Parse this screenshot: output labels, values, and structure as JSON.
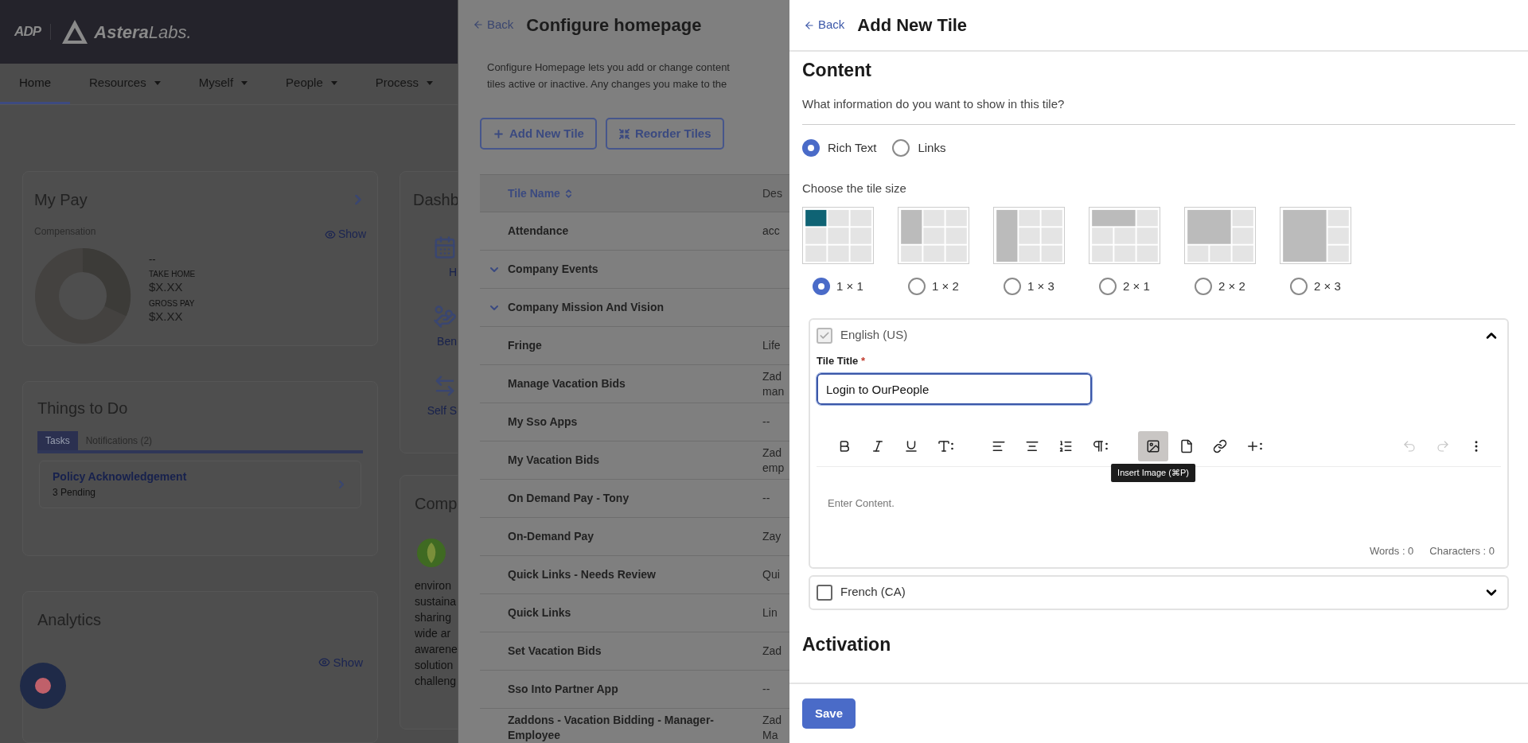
{
  "app_header": {
    "logo_mark": "ADP",
    "brand_name": "Astera",
    "brand_suffix": "Labs."
  },
  "nav": [
    {
      "label": "Home",
      "selected": true,
      "dropdown": false
    },
    {
      "label": "Resources",
      "selected": false,
      "dropdown": true
    },
    {
      "label": "Myself",
      "selected": false,
      "dropdown": true
    },
    {
      "label": "People",
      "selected": false,
      "dropdown": true
    },
    {
      "label": "Process",
      "selected": false,
      "dropdown": true
    }
  ],
  "my_pay": {
    "title": "My Pay",
    "subtitle": "Compensation",
    "show": "Show",
    "summary": "--",
    "items": [
      {
        "label": "TAKE HOME",
        "value": "$X.XX"
      },
      {
        "label": "GROSS PAY",
        "value": "$X.XX"
      }
    ]
  },
  "dashboard": {
    "title": "Dashb",
    "items": [
      {
        "kind": "calendar",
        "label": "H"
      },
      {
        "kind": "benefits",
        "label": "Ben"
      },
      {
        "kind": "swap",
        "label": "Self S"
      }
    ]
  },
  "things_to_do": {
    "title": "Things to Do",
    "tabs": [
      {
        "label": "Tasks",
        "selected": true
      },
      {
        "label": "Notifications (2)",
        "selected": false
      }
    ],
    "tasks": [
      {
        "title": "Policy Acknowledgement",
        "status": "3 Pending"
      }
    ]
  },
  "company": {
    "title": "Comp",
    "lines": [
      "environ",
      "sustaina",
      "sharing",
      "wide ar",
      "awarene",
      "solution",
      "challeng"
    ]
  },
  "analytics": {
    "title": "Analytics",
    "show": "Show"
  },
  "configure": {
    "back": "Back",
    "title": "Configure homepage",
    "description": [
      "Configure Homepage lets you add or change content",
      "tiles active or inactive. Any changes you make to the"
    ],
    "buttons": [
      {
        "kind": "add",
        "label": "Add New Tile"
      },
      {
        "kind": "reorder",
        "label": "Reorder Tiles"
      }
    ],
    "table": {
      "columns": [
        "Tile Name",
        "Des"
      ],
      "rows": [
        {
          "name": "Attendance",
          "expandable": false,
          "description": [
            "acc"
          ]
        },
        {
          "name": "Company Events",
          "expandable": true,
          "description": []
        },
        {
          "name": "Company Mission And Vision",
          "expandable": true,
          "description": []
        },
        {
          "name": "Fringe",
          "expandable": false,
          "description": [
            "Life"
          ]
        },
        {
          "name": "Manage Vacation Bids",
          "expandable": false,
          "description": [
            "Zad",
            "man"
          ]
        },
        {
          "name": "My Sso Apps",
          "expandable": false,
          "description": [
            "--"
          ]
        },
        {
          "name": "My Vacation Bids",
          "expandable": false,
          "description": [
            "Zad",
            "emp"
          ]
        },
        {
          "name": "On Demand Pay - Tony",
          "expandable": false,
          "description": [
            "--"
          ]
        },
        {
          "name": "On-Demand Pay",
          "expandable": false,
          "description": [
            "Zay"
          ]
        },
        {
          "name": "Quick Links - Needs Review",
          "expandable": false,
          "description": [
            "Qui"
          ]
        },
        {
          "name": "Quick Links",
          "expandable": false,
          "description": [
            "Lin"
          ]
        },
        {
          "name": "Set Vacation Bids",
          "expandable": false,
          "description": [
            "Zad"
          ]
        },
        {
          "name": "Sso Into Partner App",
          "expandable": false,
          "description": [
            "--"
          ]
        },
        {
          "name": "Zaddons - Vacation Bidding - Manager-Employee",
          "expandable": false,
          "description": [
            "Zad",
            "Ma"
          ]
        }
      ]
    }
  },
  "add_tile": {
    "back": "Back",
    "title": "Add New Tile",
    "content_heading": "Content",
    "question": "What information do you want to show in this tile?",
    "content_types": [
      {
        "label": "Rich Text",
        "selected": true
      },
      {
        "label": "Links",
        "selected": false
      }
    ],
    "size_prompt": "Choose the tile size",
    "sizes": [
      {
        "kind": "single",
        "label": "1 × 1",
        "selected": true
      },
      {
        "kind": "tall",
        "label": "1 × 2",
        "selected": false
      },
      {
        "kind": "column",
        "label": "1 × 3",
        "selected": false
      },
      {
        "kind": "wide",
        "label": "2 × 1",
        "selected": false
      },
      {
        "kind": "square",
        "label": "2 × 2",
        "selected": false
      },
      {
        "kind": "large",
        "label": "2 × 3",
        "selected": false
      }
    ],
    "languages": [
      {
        "label": "English (US)",
        "checked": true,
        "disabled": true,
        "expanded": true,
        "field_label": "Tile Title",
        "required_mark": "*",
        "value": "Login to OurPeople",
        "toolbar": [
          [
            {
              "kind": "bold",
              "active": false,
              "disabled": false
            },
            {
              "kind": "italic",
              "active": false,
              "disabled": false
            },
            {
              "kind": "underline",
              "active": false,
              "disabled": false
            },
            {
              "kind": "font_size",
              "active": false,
              "disabled": false
            }
          ],
          [
            {
              "kind": "align_left",
              "active": false,
              "disabled": false
            },
            {
              "kind": "align_center",
              "active": false,
              "disabled": false
            },
            {
              "kind": "ordered_list",
              "active": false,
              "disabled": false
            },
            {
              "kind": "paragraph",
              "active": false,
              "disabled": false
            }
          ],
          [
            {
              "kind": "image",
              "active": true,
              "disabled": false,
              "tooltip": "Insert Image (⌘P)"
            },
            {
              "kind": "file",
              "active": false,
              "disabled": false
            },
            {
              "kind": "link",
              "active": false,
              "disabled": false
            },
            {
              "kind": "insert",
              "active": false,
              "disabled": false
            }
          ],
          [
            {
              "kind": "undo",
              "active": false,
              "disabled": true
            },
            {
              "kind": "redo",
              "active": false,
              "disabled": true
            },
            {
              "kind": "more",
              "active": false,
              "disabled": false
            }
          ]
        ],
        "placeholder": "Enter Content.",
        "words": "Words : 0",
        "characters": "Characters : 0"
      },
      {
        "label": "French (CA)",
        "checked": false,
        "disabled": false,
        "expanded": false
      }
    ],
    "activation_heading": "Activation",
    "save": "Save"
  }
}
